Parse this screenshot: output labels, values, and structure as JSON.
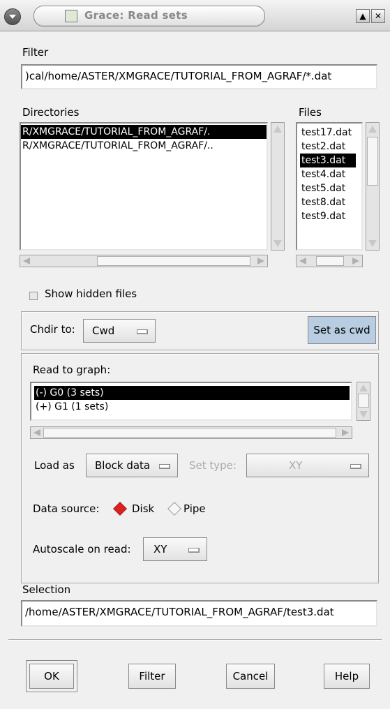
{
  "window": {
    "title": "Grace: Read sets"
  },
  "filter": {
    "label": "Filter",
    "value": ")cal/home/ASTER/XMGRACE/TUTORIAL_FROM_AGRAF/*.dat"
  },
  "directories": {
    "label": "Directories",
    "items": [
      "R/XMGRACE/TUTORIAL_FROM_AGRAF/.",
      "R/XMGRACE/TUTORIAL_FROM_AGRAF/.."
    ],
    "selected_index": 0
  },
  "files": {
    "label": "Files",
    "items": [
      "test17.dat",
      "test2.dat",
      "test3.dat",
      "test4.dat",
      "test5.dat",
      "test8.dat",
      "test9.dat"
    ],
    "selected_index": 2
  },
  "show_hidden": {
    "label": "Show hidden files",
    "checked": false
  },
  "chdir": {
    "label": "Chdir to:",
    "value": "Cwd",
    "set_cwd_label": "Set as cwd"
  },
  "read_to_graph": {
    "label": "Read to graph:",
    "items": [
      "(-) G0 (3 sets)",
      "(+) G1 (1 sets)"
    ],
    "selected_index": 0
  },
  "load_as": {
    "label": "Load as",
    "value": "Block data"
  },
  "set_type": {
    "label": "Set type:",
    "value": "XY",
    "enabled": false
  },
  "data_source": {
    "label": "Data source:",
    "options": [
      "Disk",
      "Pipe"
    ],
    "selected": "Disk"
  },
  "autoscale": {
    "label": "Autoscale on read:",
    "value": "XY"
  },
  "selection": {
    "label": "Selection",
    "value": "/home/ASTER/XMGRACE/TUTORIAL_FROM_AGRAF/test3.dat"
  },
  "buttons": {
    "ok": "OK",
    "filter": "Filter",
    "cancel": "Cancel",
    "help": "Help"
  },
  "colors": {
    "selection_bg": "#000000",
    "radio_on": "#e02020",
    "set_cwd_bg": "#b8cde2"
  }
}
